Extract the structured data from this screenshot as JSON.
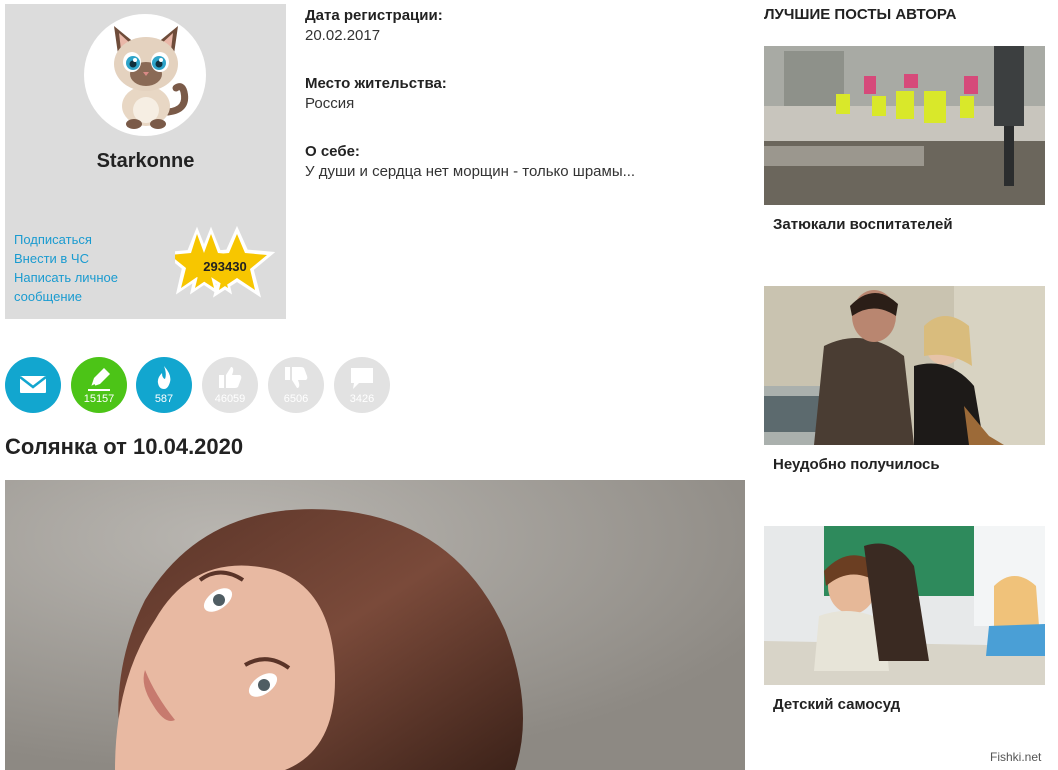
{
  "profile": {
    "username": "Starkonne",
    "links": [
      "Подписаться",
      "Внести в ЧС",
      "Написать личное сообщение"
    ],
    "rating": "293430",
    "rating_color": "#f7c600"
  },
  "info": {
    "registration_label": "Дата регистрации:",
    "registration_value": "20.02.2017",
    "location_label": "Место жительства:",
    "location_value": "Россия",
    "about_label": "О себе:",
    "about_value": "У души и сердца нет морщин - только шрамы..."
  },
  "stats": [
    {
      "icon": "mail-icon",
      "count": ""
    },
    {
      "icon": "pen-icon",
      "count": "15157"
    },
    {
      "icon": "flame-icon",
      "count": "587"
    },
    {
      "icon": "thumbs-up-icon",
      "count": "46059"
    },
    {
      "icon": "thumbs-down-icon",
      "count": "6506"
    },
    {
      "icon": "comment-icon",
      "count": "3426"
    }
  ],
  "post": {
    "title": "Солянка от 10.04.2020"
  },
  "sidebar": {
    "title": "ЛУЧШИЕ ПОСТЫ АВТОРА",
    "posts": [
      {
        "caption": "Затюкали воспитателей"
      },
      {
        "caption": "Неудобно получилось"
      },
      {
        "caption": "Детский самосуд"
      }
    ]
  },
  "watermark": "Fishki.net",
  "colors": {
    "accent_blue": "#12a6cf",
    "accent_green": "#4cc417",
    "link": "#1a9bd0",
    "inactive": "#e2e2e2"
  }
}
